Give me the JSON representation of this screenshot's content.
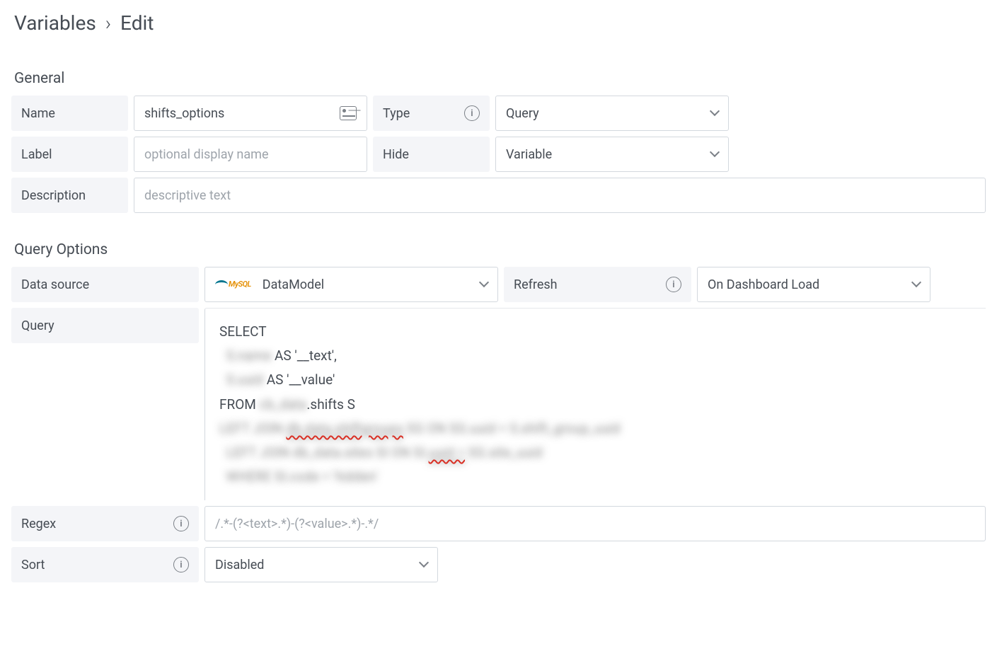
{
  "breadcrumb": {
    "root": "Variables",
    "current": "Edit"
  },
  "sections": {
    "general": {
      "title": "General",
      "name_label": "Name",
      "name_value": "shifts_options",
      "type_label": "Type",
      "type_value": "Query",
      "label_label": "Label",
      "label_placeholder": "optional display name",
      "hide_label": "Hide",
      "hide_value": "Variable",
      "description_label": "Description",
      "description_placeholder": "descriptive text"
    },
    "query_options": {
      "title": "Query Options",
      "datasource_label": "Data source",
      "datasource_value": "DataModel",
      "refresh_label": "Refresh",
      "refresh_value": "On Dashboard Load",
      "query_label": "Query",
      "query_lines": [
        {
          "t": "SELECT"
        },
        {
          "t": "  ",
          "blur": "S.name",
          "tail": " AS '__text',"
        },
        {
          "t": "  ",
          "blur": "S.uuid",
          "tail": " AS '__value'"
        },
        {
          "t": "FROM ",
          "blur": "cb_data",
          "tail": ".shifts S"
        },
        {
          "t": "",
          "blurline": "LEFT JOIN ",
          "red": "db.data.shiftgroups",
          "blurtail": " SG ON SG.uuid = S.shift_group_uuid"
        },
        {
          "t": "  ",
          "blurline": "LEFT JOIN db_data.sites SI ON SI.",
          "red": "uuid =",
          "blurtail": " SG.site_uuid"
        },
        {
          "t": "  ",
          "blurline": "WHERE SI.code = 'hidden'"
        }
      ],
      "regex_label": "Regex",
      "regex_placeholder": "/.*-(?<text>.*)-(?<value>.*)-.*/",
      "sort_label": "Sort",
      "sort_value": "Disabled"
    }
  }
}
